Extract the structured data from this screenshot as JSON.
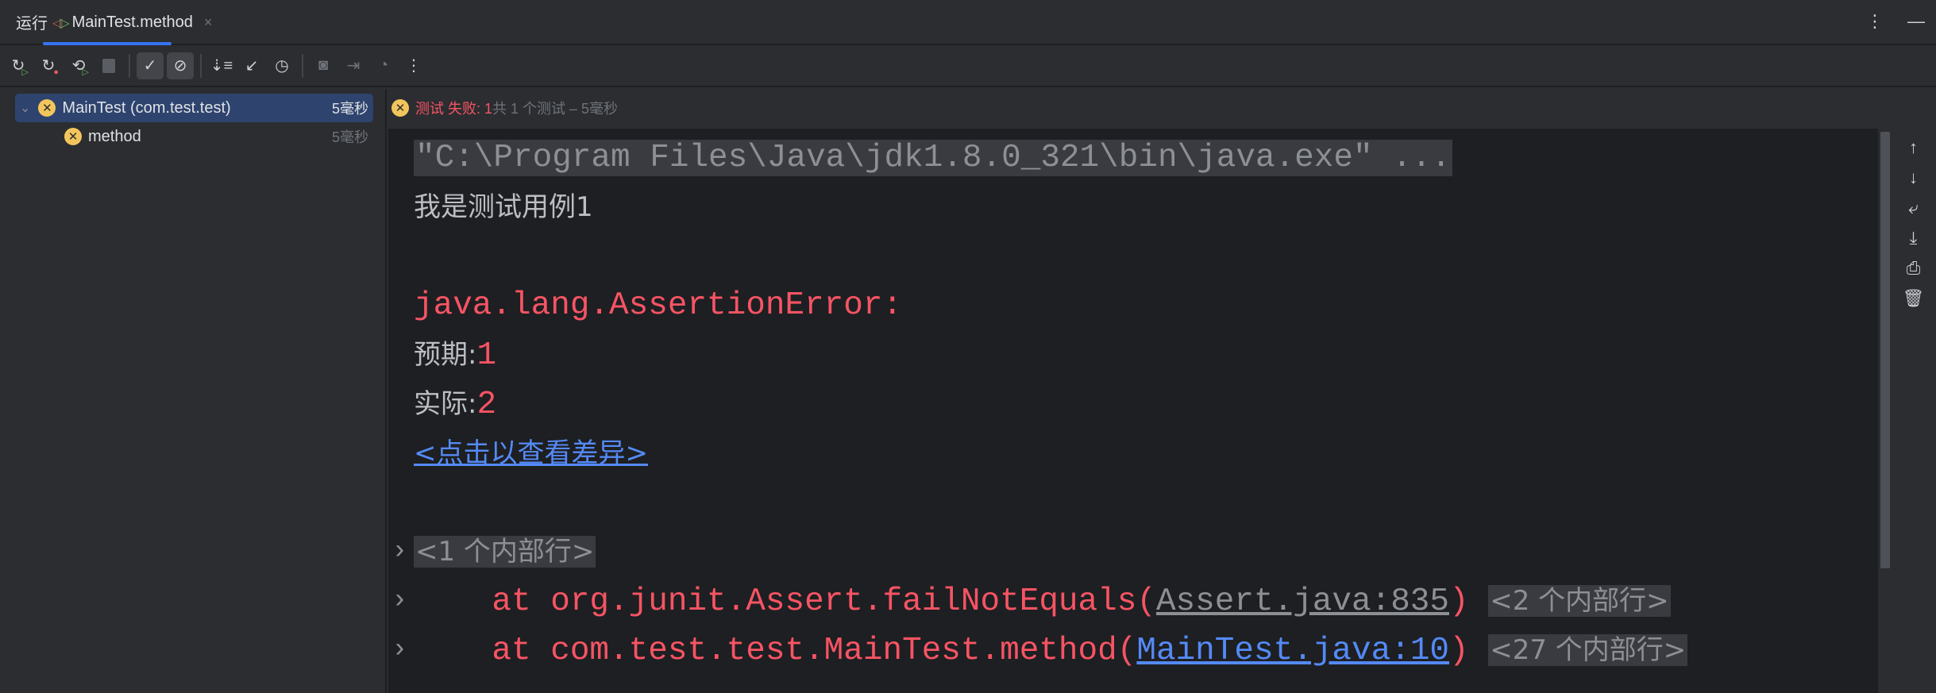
{
  "tabbar": {
    "run_label": "运行",
    "tab_label": "MainTest.method",
    "close": "×",
    "more": "⋮",
    "minimize": "—"
  },
  "toolbar": {
    "icons": [
      "rerun-icon",
      "rerun-failed-icon",
      "toggle-autotest-icon",
      "stop-icon",
      "show-passed-icon",
      "show-ignored-icon",
      "sort-icon",
      "collapse-icon",
      "history-icon",
      "camera-icon",
      "import-icon",
      "coverage-icon",
      "more-icon"
    ]
  },
  "tree": {
    "root": {
      "label": "MainTest (com.test.test)",
      "time": "5毫秒"
    },
    "child": {
      "label": "method",
      "time": "5毫秒"
    }
  },
  "status": {
    "failed_label": "测试 失败: 1",
    "summary": "共 1 个测试 – 5毫秒"
  },
  "console": {
    "cmd": "\"C:\\Program Files\\Java\\jdk1.8.0_321\\bin\\java.exe\" ...",
    "out1": "我是测试用例1",
    "error": "java.lang.AssertionError:",
    "expected_label": "预期:",
    "expected_value": "1",
    "actual_label": "实际:",
    "actual_value": "2",
    "diff_link": "<点击以查看差异>",
    "internal1": "<1 个内部行>",
    "trace1_prefix": "    at org.junit.Assert.failNotEquals(",
    "trace1_link": "Assert.java:835",
    "trace1_suffix": ")",
    "trace1_internal": "<2 个内部行>",
    "trace2_prefix": "    at com.test.test.MainTest.method(",
    "trace2_link": "MainTest.java:10",
    "trace2_suffix": ")",
    "trace2_internal": "<27 个内部行>"
  },
  "colors": {
    "accent": "#3574f0",
    "error": "#f75464",
    "link": "#548af7",
    "warning": "#f2c55c"
  }
}
